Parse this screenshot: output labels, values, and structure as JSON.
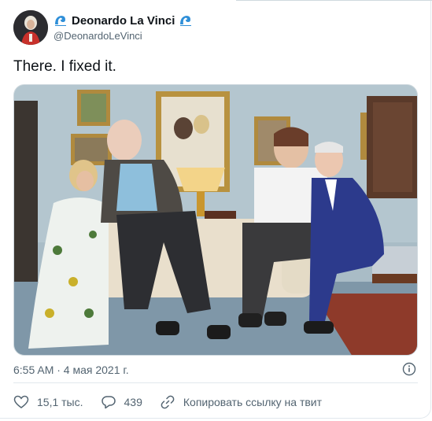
{
  "user": {
    "name": "Deonardo La Vinci",
    "handle": "@DeonardoLeVinci"
  },
  "tweet": {
    "text": "There. I fixed it.",
    "timestamp": "6:55 AM · 4 мая 2021 г."
  },
  "actions": {
    "likes": "15,1 тыс.",
    "replies": "439",
    "copy_link": "Копировать ссылку на твит"
  },
  "colors": {
    "accent": "#1d9bf0",
    "secondary_text": "#536471",
    "wave_emoji": "#2f8fd8"
  },
  "icons": [
    "wave-emoji-icon",
    "info-icon",
    "heart-icon",
    "reply-icon",
    "link-icon"
  ]
}
